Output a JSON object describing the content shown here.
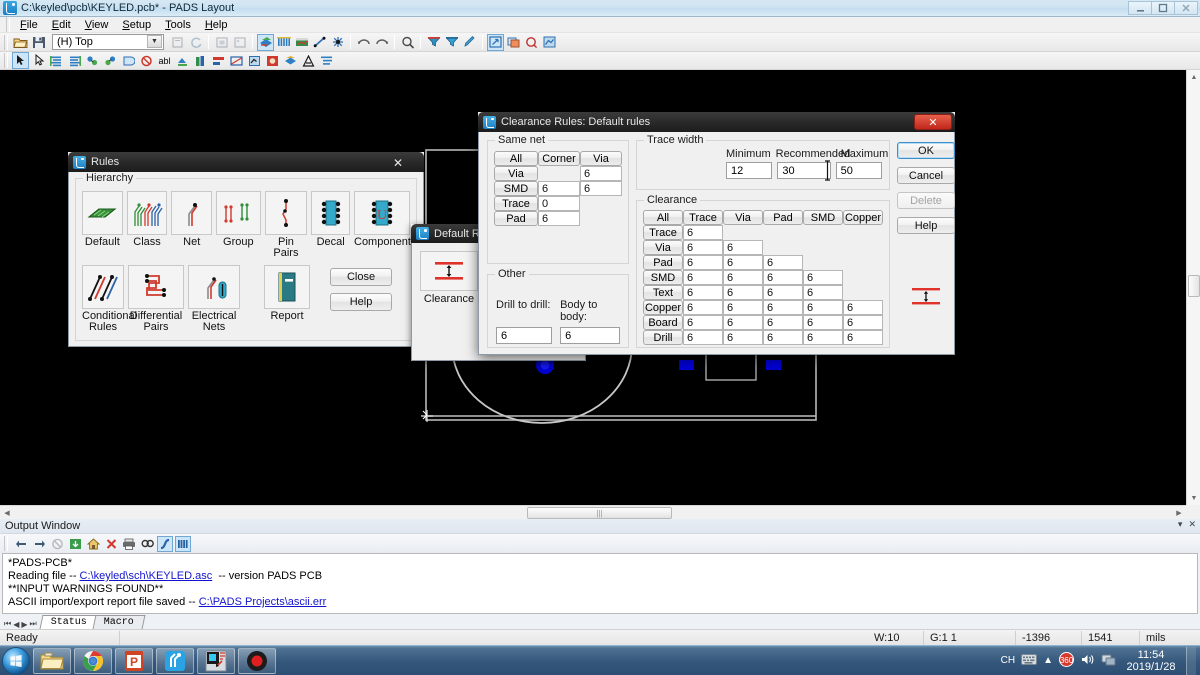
{
  "window": {
    "title": "C:\\keyled\\pcb\\KEYLED.pcb* - PADS Layout",
    "icon": "pads-layout-icon",
    "minimize": "—",
    "maximize": "❐",
    "close": "✕"
  },
  "menubar": {
    "items": [
      "File",
      "Edit",
      "View",
      "Setup",
      "Tools",
      "Help"
    ]
  },
  "toolbar": {
    "layer_combo_value": "(H) Top",
    "layer_combo_arrow": "▼",
    "icons": [
      "open-icon",
      "save-icon",
      "print-preview-icon",
      "refresh-icon",
      "copy-to-clipboard-icon",
      "paste-image-icon",
      "layer-setup-icon",
      "design-grid-icon",
      "drafting-icon",
      "line-tool-icon",
      "via-tool-icon",
      "undo-icon",
      "redo-icon",
      "zoom-icon",
      "filter-down-icon",
      "filter-up-icon",
      "highlight-icon",
      "pan-icon",
      "board-outline-icon",
      "cam-icon",
      "net-icon"
    ],
    "icons2": [
      "select-arrow-icon",
      "pointer-icon",
      "route-icon",
      "route-alt-icon",
      "cluster-icon",
      "cluster-alt-icon",
      "split-plane-icon",
      "no-entry-icon",
      "abl-icon",
      "pour-icon",
      "measure-icon",
      "dimension-icon",
      "dimension-alt-icon",
      "copper-icon",
      "drc-icon",
      "layer-icon",
      "text-icon",
      "list-icon"
    ]
  },
  "output_window": {
    "title": "Output Window",
    "minimize": "▾",
    "close": "✕",
    "toolbar_icons": [
      "back-arrow-icon",
      "forward-arrow-icon",
      "stop-icon",
      "export-icon",
      "home-icon",
      "delete-x-icon",
      "print-icon",
      "find-icon",
      "jump-icon",
      "columns-icon"
    ],
    "lines": [
      {
        "parts": [
          {
            "text": "*PADS-PCB*",
            "link": false
          }
        ]
      },
      {
        "parts": [
          {
            "text": "Reading file -- ",
            "link": false
          },
          {
            "text": "C:\\keyled\\sch\\KEYLED.asc",
            "link": true
          },
          {
            "text": "  -- version PADS PCB",
            "link": false
          }
        ]
      },
      {
        "parts": [
          {
            "text": "**INPUT WARNINGS FOUND**",
            "link": false
          }
        ]
      },
      {
        "parts": [
          {
            "text": "ASCII import/export report file saved -- ",
            "link": false
          },
          {
            "text": "C:\\PADS Projects\\ascii.err",
            "link": true
          }
        ]
      }
    ],
    "tabs": [
      {
        "label": "Status",
        "active": true
      },
      {
        "label": "Macro",
        "active": false
      }
    ],
    "tab_navs": [
      "|◀",
      "◀",
      "▶",
      "▶|"
    ]
  },
  "statusbar": {
    "ready": "Ready",
    "width": "W:10",
    "grid": "G:1 1",
    "x": "-1396",
    "y": "1541",
    "units": "mils"
  },
  "taskbar": {
    "start": "start-orb",
    "apps": [
      "explorer-icon",
      "chrome-icon",
      "powerpoint-icon",
      "pads-logic-icon",
      "pads-layout-icon",
      "recorder-icon"
    ],
    "tray": {
      "ime": "CH",
      "keyboard": "keyboard-icon",
      "expand": "▲",
      "icons": [
        "volume-icon",
        "network-icon",
        "antivirus-icon"
      ],
      "time": "11:54",
      "date": "2019/1/28"
    }
  },
  "rules_dialog": {
    "title": "Rules",
    "icon": "pads-layout-icon",
    "close": "✕",
    "hierarchy_label": "Hierarchy",
    "row1": [
      {
        "label": "Default",
        "icon": "board-default-icon"
      },
      {
        "label": "Class",
        "icon": "net-class-icon"
      },
      {
        "label": "Net",
        "icon": "net-icon"
      },
      {
        "label": "Group",
        "icon": "group-icon"
      },
      {
        "label": "Pin Pairs",
        "icon": "pin-pairs-icon"
      },
      {
        "label": "Decal",
        "icon": "decal-icon"
      },
      {
        "label": "Component",
        "icon": "component-icon"
      }
    ],
    "row2": [
      {
        "label": "Conditional\nRules",
        "icon": "conditional-rules-icon"
      },
      {
        "label": "Differential\nPairs",
        "icon": "differential-pairs-icon"
      },
      {
        "label": "Electrical\nNets",
        "icon": "electrical-nets-icon"
      },
      {
        "label": "Report",
        "icon": "report-icon"
      }
    ],
    "buttons": [
      "Close",
      "Help"
    ]
  },
  "default_rules_dialog": {
    "title": "Default Ru",
    "icon": "pads-layout-icon",
    "tile_label": "Clearance",
    "tile_icon": "clearance-icon"
  },
  "clearance_dialog": {
    "title": "Clearance Rules: Default rules",
    "icon": "pads-layout-icon",
    "close": "✕",
    "same_net": {
      "label": "Same net",
      "columns": [
        "All",
        "Corner",
        "Via"
      ],
      "rows": [
        {
          "label": "Via",
          "values": [
            null,
            "6"
          ]
        },
        {
          "label": "SMD",
          "values": [
            "6",
            "6"
          ]
        },
        {
          "label": "Trace",
          "values": [
            "0",
            null
          ]
        },
        {
          "label": "Pad",
          "values": [
            "6",
            null
          ]
        }
      ]
    },
    "other": {
      "label": "Other",
      "fields": [
        {
          "label": "Drill to drill:",
          "value": "6"
        },
        {
          "label": "Body to body:",
          "value": "6"
        }
      ]
    },
    "trace_width": {
      "label": "Trace width",
      "columns": [
        "Minimum",
        "Recommended",
        "Maximum"
      ],
      "values": [
        "12",
        "30",
        "50"
      ]
    },
    "clearance": {
      "label": "Clearance",
      "columns": [
        "All",
        "Trace",
        "Via",
        "Pad",
        "SMD",
        "Copper"
      ],
      "rows": [
        {
          "label": "Trace",
          "values": [
            "6"
          ]
        },
        {
          "label": "Via",
          "values": [
            "6",
            "6"
          ]
        },
        {
          "label": "Pad",
          "values": [
            "6",
            "6",
            "6"
          ]
        },
        {
          "label": "SMD",
          "values": [
            "6",
            "6",
            "6",
            "6"
          ]
        },
        {
          "label": "Text",
          "values": [
            "6",
            "6",
            "6",
            "6"
          ]
        },
        {
          "label": "Copper",
          "values": [
            "6",
            "6",
            "6",
            "6",
            "6"
          ]
        },
        {
          "label": "Board",
          "values": [
            "6",
            "6",
            "6",
            "6",
            "6"
          ]
        },
        {
          "label": "Drill",
          "values": [
            "6",
            "6",
            "6",
            "6",
            "6"
          ]
        }
      ]
    },
    "buttons": [
      {
        "label": "OK",
        "state": "default"
      },
      {
        "label": "Cancel",
        "state": "normal"
      },
      {
        "label": "Delete",
        "state": "disabled"
      },
      {
        "label": "Help",
        "state": "normal"
      }
    ],
    "preview_icon": "clearance-icon"
  },
  "colors": {
    "accent": "#3d8fc9",
    "canvas_bg": "#000000",
    "pad_blue": "#0000d2",
    "outline_gray": "#c0c0c0",
    "link_blue": "#1414cf",
    "close_red": "#c0271a"
  }
}
